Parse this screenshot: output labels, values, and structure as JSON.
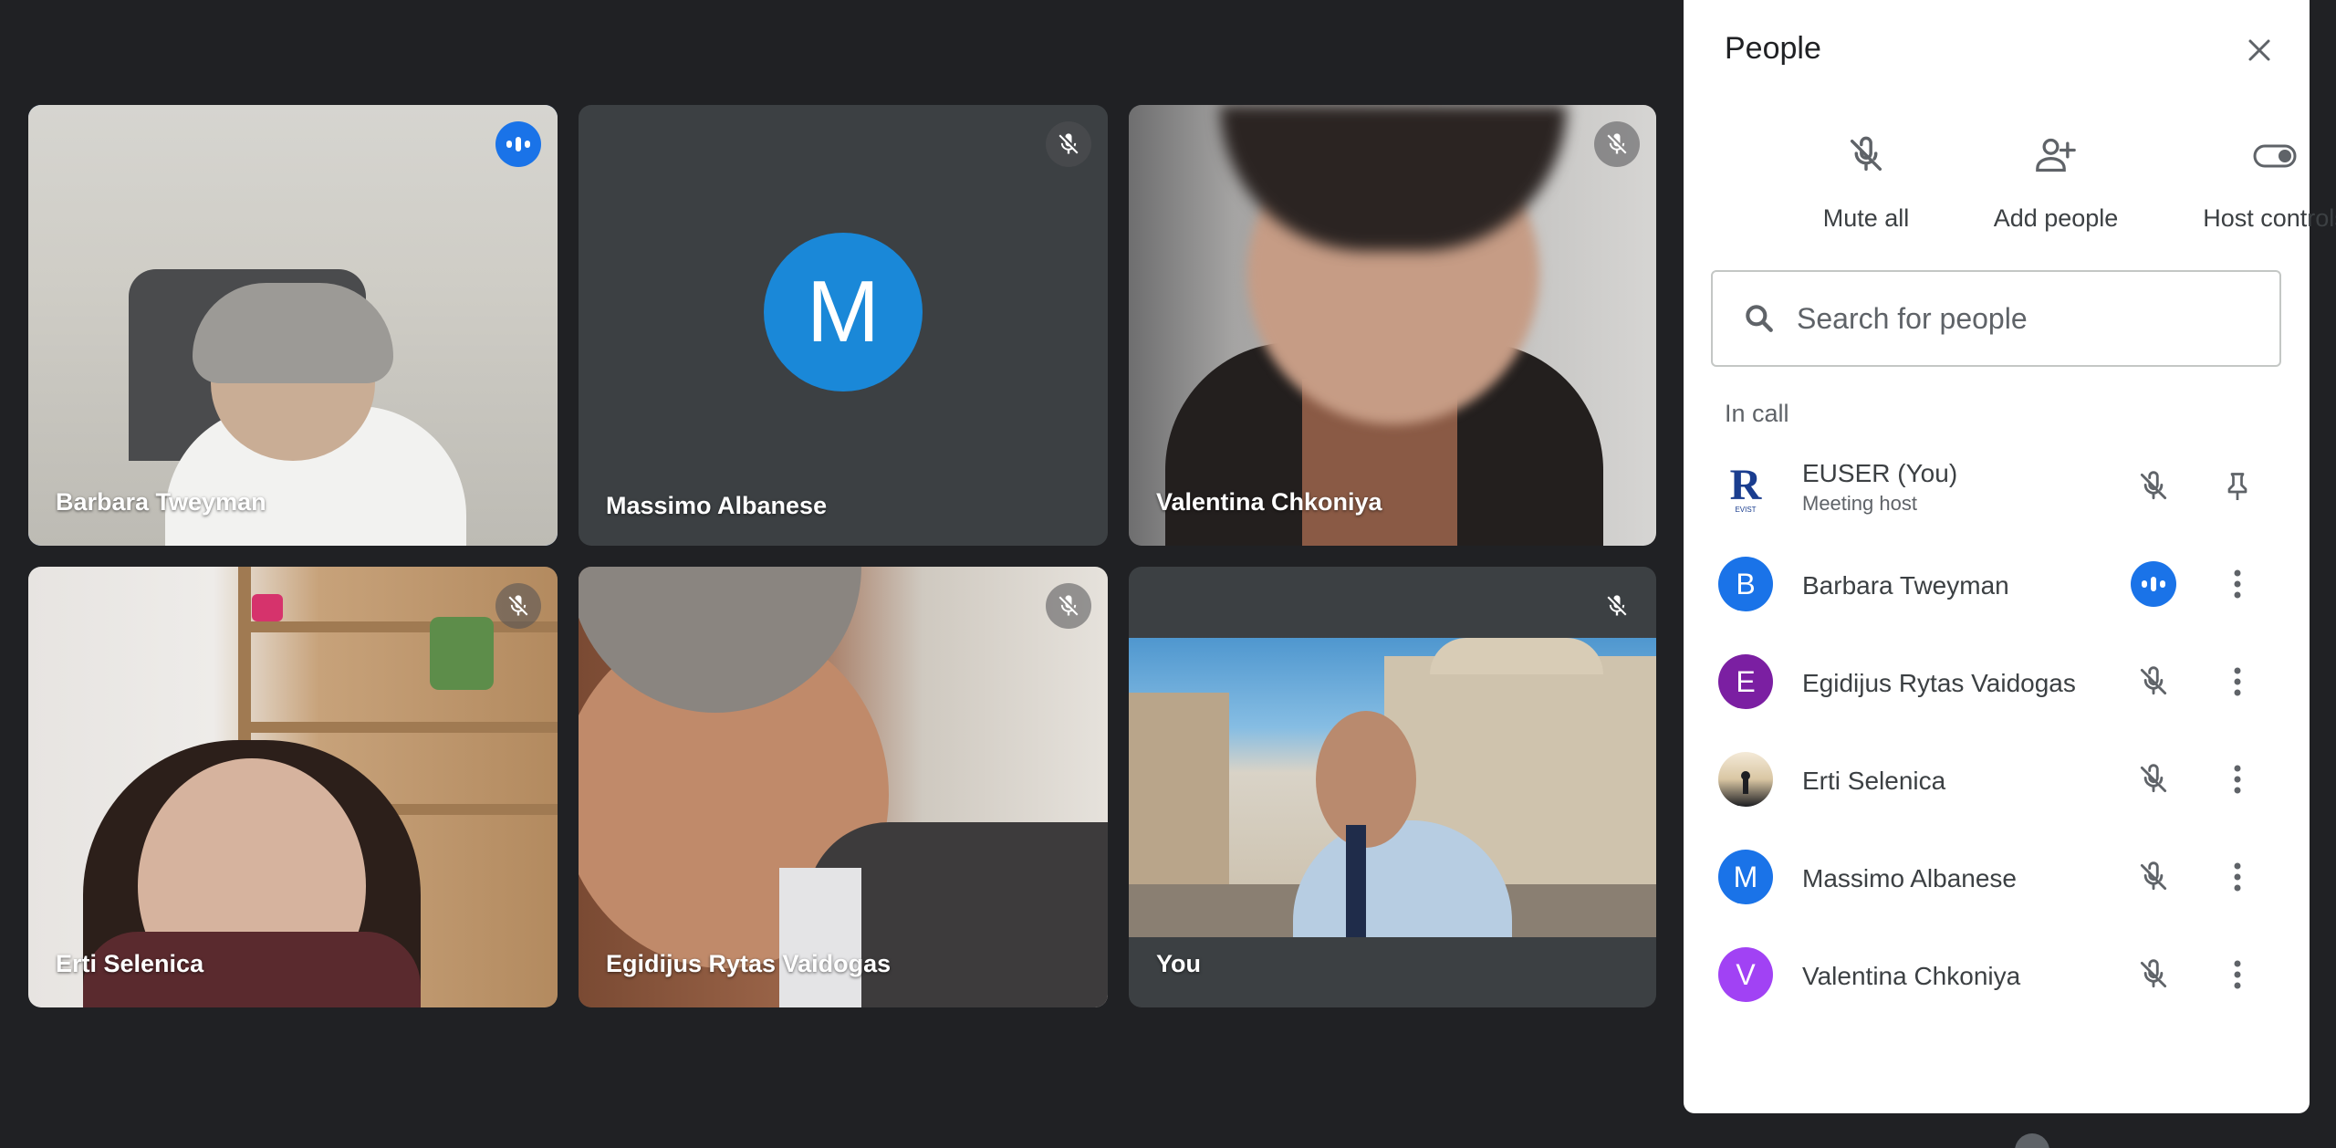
{
  "tiles": [
    {
      "name": "Barbara Tweyman",
      "status": "speaking"
    },
    {
      "name": "Massimo Albanese",
      "status": "muted",
      "initial": "M"
    },
    {
      "name": "Valentina Chkoniya",
      "status": "muted"
    },
    {
      "name": "Erti Selenica",
      "status": "muted"
    },
    {
      "name": "Egidijus Rytas Vaidogas",
      "status": "muted"
    },
    {
      "name": "You",
      "status": "muted"
    }
  ],
  "panel": {
    "title": "People",
    "actions": {
      "mute_all": "Mute all",
      "add_people": "Add people",
      "host_controls": "Host controls"
    },
    "search_placeholder": "Search for people",
    "section_label": "In call",
    "participants": [
      {
        "name": "EUSER (You)",
        "subtitle": "Meeting host",
        "avatar": "R",
        "logo_text": "EVIST"
      },
      {
        "name": "Barbara Tweyman",
        "initial": "B",
        "color": "#1a73e8",
        "status": "speaking"
      },
      {
        "name": "Egidijus Rytas Vaidogas",
        "initial": "E",
        "color": "#7b1fa2",
        "status": "muted"
      },
      {
        "name": "Erti Selenica",
        "status": "muted"
      },
      {
        "name": "Massimo Albanese",
        "initial": "M",
        "color": "#1a73e8",
        "status": "muted"
      },
      {
        "name": "Valentina Chkoniya",
        "initial": "V",
        "color": "#a142f4",
        "status": "muted"
      }
    ]
  },
  "colors": {
    "accent": "#1a73e8",
    "background": "#202124",
    "active_outline": "#8ab4f8"
  }
}
